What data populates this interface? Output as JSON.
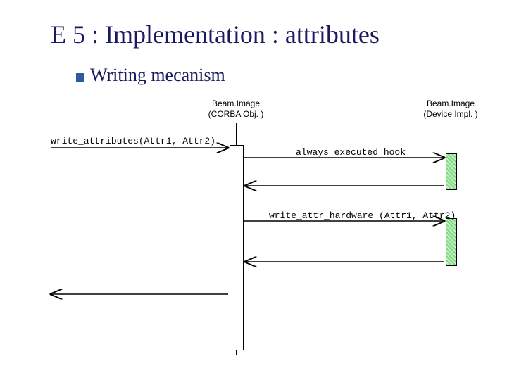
{
  "title": "E 5 : Implementation : attributes",
  "subhead": "Writing mecanism",
  "lifelines": {
    "corba": {
      "line1": "Beam.Image",
      "line2": "(CORBA Obj. )"
    },
    "impl": {
      "line1": "Beam.Image",
      "line2": "(Device Impl. )"
    }
  },
  "messages": {
    "write_attributes": "write_attributes(Attr1, Attr2)",
    "always_hook": "always_executed_hook",
    "write_hw": "write_attr_hardware (Attr1, Attr2)"
  }
}
